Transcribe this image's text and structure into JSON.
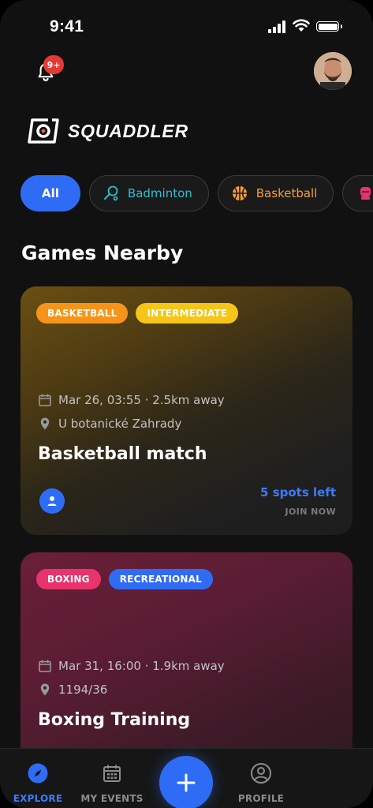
{
  "status_bar": {
    "time": "9:41"
  },
  "header": {
    "notification_count": "9+",
    "brand": "SQUADDLER"
  },
  "filters": [
    {
      "label": "All",
      "active": true
    },
    {
      "label": "Badminton",
      "icon": "badminton-icon",
      "color": "#2bc0d0"
    },
    {
      "label": "Basketball",
      "icon": "basketball-icon",
      "color": "#f5a033"
    },
    {
      "label": "",
      "icon": "boxing-icon",
      "color": "#e8336c"
    }
  ],
  "section_title": "Games Nearby",
  "games": [
    {
      "tags": [
        {
          "label": "BASKETBALL",
          "color": "#f59419"
        },
        {
          "label": "INTERMEDIATE",
          "color": "#f5c518"
        }
      ],
      "datetime": "Mar 26, 03:55 · 2.5km away",
      "location": "U botanické Zahrady",
      "title": "Basketball match",
      "spots": "5 spots left",
      "cta": "JOIN NOW"
    },
    {
      "tags": [
        {
          "label": "BOXING",
          "color": "#e8336c"
        },
        {
          "label": "RECREATIONAL",
          "color": "#2f6cf6"
        }
      ],
      "datetime": "Mar 31, 16:00 · 1.9km away",
      "location": "1194/36",
      "title": "Boxing Training"
    }
  ],
  "nav": {
    "explore": "EXPLORE",
    "my_events": "MY EVENTS",
    "profile": "PROFILE"
  },
  "colors": {
    "accent": "#2f6cf6",
    "background": "#111111"
  }
}
